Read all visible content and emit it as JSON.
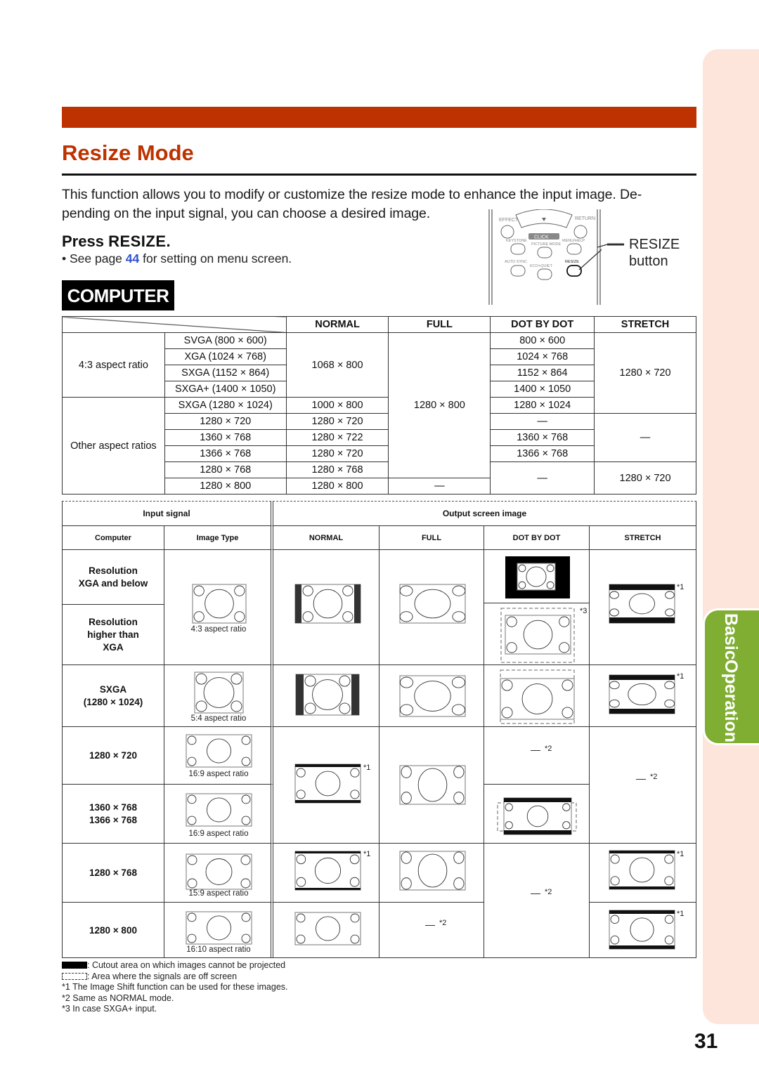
{
  "section": {
    "title": "Resize Mode",
    "intro_line1": "This function allows you to modify or customize the resize mode to enhance the input image. De-",
    "intro_line2": "pending on the input signal, you can choose a desired image.",
    "press_prefix": "Press ",
    "press_key": "RESIZE",
    "press_suffix": ".",
    "see_prefix": "• See page ",
    "see_page": "44",
    "see_suffix": " for setting on menu screen.",
    "badge": "COMPUTER"
  },
  "remote": {
    "labels": [
      "EFFECT",
      "RETURN",
      "KEYSTONE",
      "CLICK",
      "MENU/HELP",
      "PICTURE MODE",
      "AUTO SYNC",
      "ECO+QUIET",
      "RESIZE"
    ],
    "callout_line1": "RESIZE",
    "callout_line2": "button"
  },
  "resolution_table": {
    "headers": [
      "NORMAL",
      "FULL",
      "DOT BY DOT",
      "STRETCH"
    ],
    "groups": [
      "4:3 aspect ratio",
      "Other aspect ratios"
    ],
    "rows": [
      {
        "input": "SVGA (800 × 600)",
        "normal": "1068 × 800",
        "full": "1280 × 800",
        "dot": "800 × 600",
        "stretch": "1280 × 720"
      },
      {
        "input": "XGA (1024 × 768)",
        "dot": "1024 × 768"
      },
      {
        "input": "SXGA (1152 × 864)",
        "dot": "1152 × 864"
      },
      {
        "input": "SXGA+ (1400 × 1050)",
        "dot": "1400 × 1050"
      },
      {
        "input": "SXGA (1280 × 1024)",
        "normal": "1000 × 800",
        "dot": "1280 × 1024"
      },
      {
        "input": "1280 × 720",
        "normal": "1280 × 720",
        "dot": "—",
        "stretch": "—"
      },
      {
        "input": "1360 × 768",
        "normal": "1280 × 722",
        "dot": "1360 × 768"
      },
      {
        "input": "1366 × 768",
        "normal": "1280 × 720",
        "dot": "1366 × 768"
      },
      {
        "input": "1280 × 768",
        "normal": "1280 × 768",
        "dot": "—",
        "stretch": "1280 × 720"
      },
      {
        "input": "1280 × 800",
        "normal": "1280 × 800",
        "full": "—"
      }
    ]
  },
  "image_table": {
    "input_signal": "Input signal",
    "output_screen_image": "Output screen image",
    "col_computer": "Computer",
    "col_image_type": "Image Type",
    "col_normal": "NORMAL",
    "col_full": "FULL",
    "col_dot": "DOT BY DOT",
    "col_stretch": "STRETCH",
    "rows": [
      {
        "label": "Resolution\nXGA and below"
      },
      {
        "label": "Resolution\nhigher than\nXGA",
        "image_type": "4:3 aspect ratio"
      },
      {
        "label": "SXGA\n(1280 × 1024)",
        "image_type": "5:4 aspect ratio"
      },
      {
        "label": "1280 × 720",
        "image_type": "16:9 aspect ratio"
      },
      {
        "label": "1360 × 768\n1366 × 768",
        "image_type": "16:9 aspect ratio"
      },
      {
        "label": "1280 × 768",
        "image_type": "15:9 aspect ratio"
      },
      {
        "label": "1280 × 800",
        "image_type": "16:10 aspect ratio"
      }
    ],
    "notes": {
      "n1": "*1",
      "n2": "*2",
      "n3": "*3",
      "same": "—"
    }
  },
  "legend": {
    "cutout": ": Cutout area on which images cannot be projected",
    "offscreen": ": Area where the signals are off screen",
    "note1": "*1 The Image Shift function can be used for these images.",
    "note2": "*2 Same as NORMAL mode.",
    "note3": "*3 In case SXGA+ input."
  },
  "side_tab": {
    "line1": "Basic",
    "line2": "Operation"
  },
  "page_number": "31",
  "colors": {
    "accent": "#bd3200",
    "tab_green": "#7fae32",
    "tab_bg": "#fde5db",
    "link": "#2a4fd4"
  }
}
